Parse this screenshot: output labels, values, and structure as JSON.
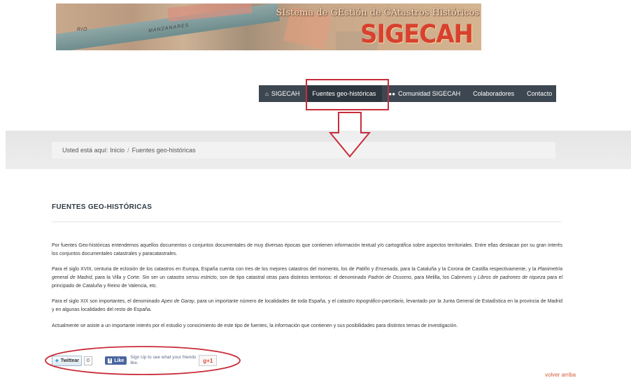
{
  "banner": {
    "map_label_1": "RIO",
    "map_label_2": "MANZANARES",
    "subtitle": "SIstema de GEstión de CAtastros Históricos",
    "logo": "SIGECAH"
  },
  "nav": {
    "items": [
      {
        "label": "SIGECAH",
        "icon": "home-icon"
      },
      {
        "label": "Fuentes geo-históricas"
      },
      {
        "label": "Comunidad SIGECAH",
        "icon": "users-icon"
      },
      {
        "label": "Colaboradores"
      },
      {
        "label": "Contacto"
      }
    ],
    "highlight_color": "#c82d3a",
    "background": "#3d4751"
  },
  "breadcrumb": {
    "prefix": "Usted está aquí:",
    "home": "Inicio",
    "separator": "/",
    "current": "Fuentes geo-históricas"
  },
  "page": {
    "title": "FUENTES GEO-HISTÓRICAS",
    "p1": "Por fuentes Geo-históricas entendemos aquellos documentos o conjuntos documentales de muy diversas épocas que contienen información textual y/o cartográfica sobre aspectos territoriales. Entre ellas destacan por su gran interés los conjuntos documentales catastrales y paracatastrales.",
    "p2": {
      "a": "Para el siglo XVIII, centuria de eclosión de los catastros en Europa, España cuenta con tres de los mejores catastros del momento, los de ",
      "b": "Patiño",
      "c": " y ",
      "d": "Ensenada",
      "e": ", para la Cataluña y la Corona de Castilla respectivamente,  y la ",
      "f": "Planimetría general de Madrid",
      "g": ", para la Villa y Corte. Sin ser un catastro ",
      "h": "sensu estricto",
      "i": ", son de tipo  catastral otras para distintos territorios: el denominado ",
      "j": "Padrón de Ossorno",
      "k": ", para Melilla, los ",
      "l": "Cabreves",
      "m": " y ",
      "n": "Libros de padrones de riqueza",
      "o": " para el principado de Cataluña y Reino de Valencia, etc."
    },
    "p3": {
      "a": "Para el siglo XIX son importantes, el denominado ",
      "b": "Apeo de Garay",
      "c": ", para un importante número de localidades de toda España, y el ",
      "d": "catastro topográfico-parcelario",
      "e": ", levantado por la Junta General de Estadística en la provincia de Madrid y en algunas localidades del resto de España."
    },
    "p4": "Actualmente se asiste a un importante interés por el estudio y conocimiento de este tipo de fuentes,  la información que contienen y sus posibilidades para distintos temas de investigación."
  },
  "social": {
    "twitter_label": "Twittear",
    "twitter_count": "0",
    "fb_label": "Like",
    "fb_text": "Sign Up to see what your friends like.",
    "gplus_label": "g+1"
  },
  "footer": {
    "back_to_top": "volver arriba"
  }
}
